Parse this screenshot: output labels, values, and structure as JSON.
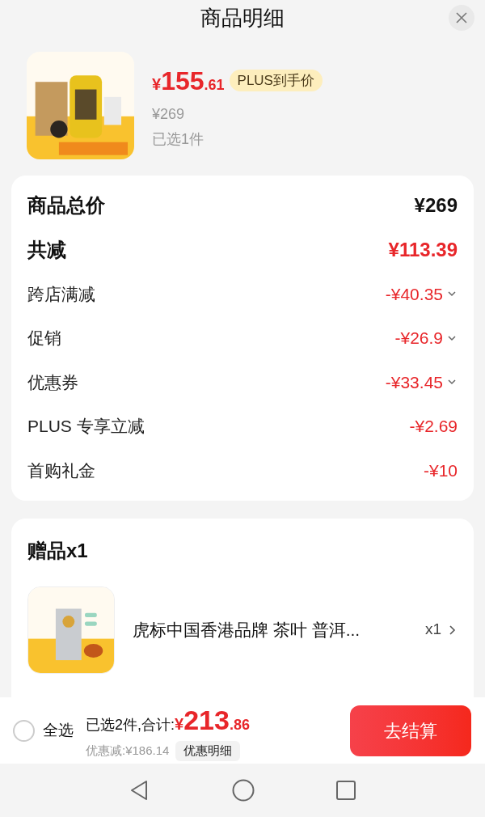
{
  "header": {
    "title": "商品明细"
  },
  "product": {
    "price": {
      "currency": "¥",
      "integer": "155",
      "decimal": ".61"
    },
    "price_tag": "PLUS到手价",
    "original_price": "¥269",
    "selected_count": "已选1件"
  },
  "summary": {
    "rows": [
      {
        "kind": "total",
        "label": "商品总价",
        "value": "¥269",
        "expandable": false
      },
      {
        "kind": "sum",
        "label": "共减",
        "value": "¥113.39",
        "expandable": false
      },
      {
        "kind": "discount",
        "label": "跨店满减",
        "value": "-¥40.35",
        "expandable": true
      },
      {
        "kind": "discount",
        "label": "促销",
        "value": "-¥26.9",
        "expandable": true
      },
      {
        "kind": "discount",
        "label": "优惠券",
        "value": "-¥33.45",
        "expandable": true
      },
      {
        "kind": "discount",
        "label": "PLUS 专享立减",
        "value": "-¥2.69",
        "expandable": false
      },
      {
        "kind": "discount",
        "label": "首购礼金",
        "value": "-¥10",
        "expandable": false
      }
    ]
  },
  "gifts": {
    "title": "赠品x1",
    "items": [
      {
        "name": "虎标中国香港品牌 茶叶 普洱...",
        "quantity": "x1"
      }
    ]
  },
  "footer": {
    "select_all": {
      "label": "全选",
      "checked": false
    },
    "summary_label": "已选2件,合计:",
    "total": {
      "currency": "¥",
      "integer": "213",
      "decimal": ".86"
    },
    "discount_text": "优惠减:¥186.14",
    "detail_button": "优惠明细",
    "checkout_button": "去结算"
  }
}
